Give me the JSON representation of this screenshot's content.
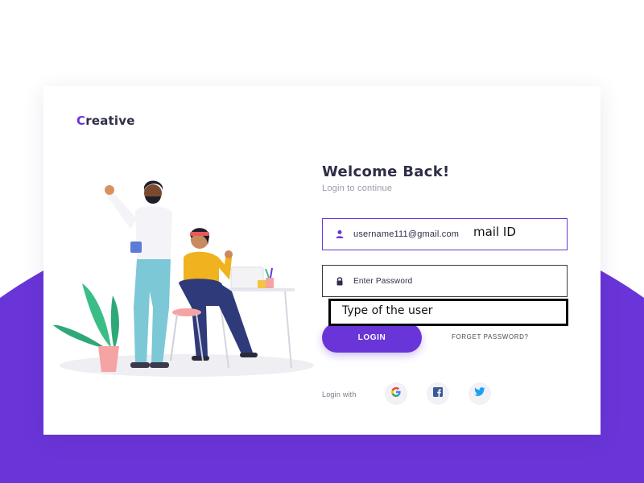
{
  "brand": {
    "first_letter": "C",
    "rest": "reative"
  },
  "form": {
    "title": "Welcome Back!",
    "subtitle": "Login to continue",
    "email_value": "username111@gmail.com",
    "password_placeholder": "Enter Password",
    "login_label": "LOGIN",
    "forgot_label": "FORGET PASSWORD?",
    "login_with_label": "Login with"
  },
  "annotations": {
    "mail_note": "mail ID",
    "type_note": "Type of the user"
  },
  "social": [
    {
      "name": "google",
      "icon": "google-icon"
    },
    {
      "name": "facebook",
      "icon": "facebook-icon"
    },
    {
      "name": "twitter",
      "icon": "twitter-icon"
    }
  ],
  "colors": {
    "accent": "#6a35d8",
    "text_dark": "#2e2e48",
    "text_muted": "#9a9aaa",
    "google": "#ea4335",
    "facebook": "#3b5998",
    "twitter": "#1da1f2"
  },
  "illustration": {
    "subject": "man-and-woman-at-desk"
  }
}
